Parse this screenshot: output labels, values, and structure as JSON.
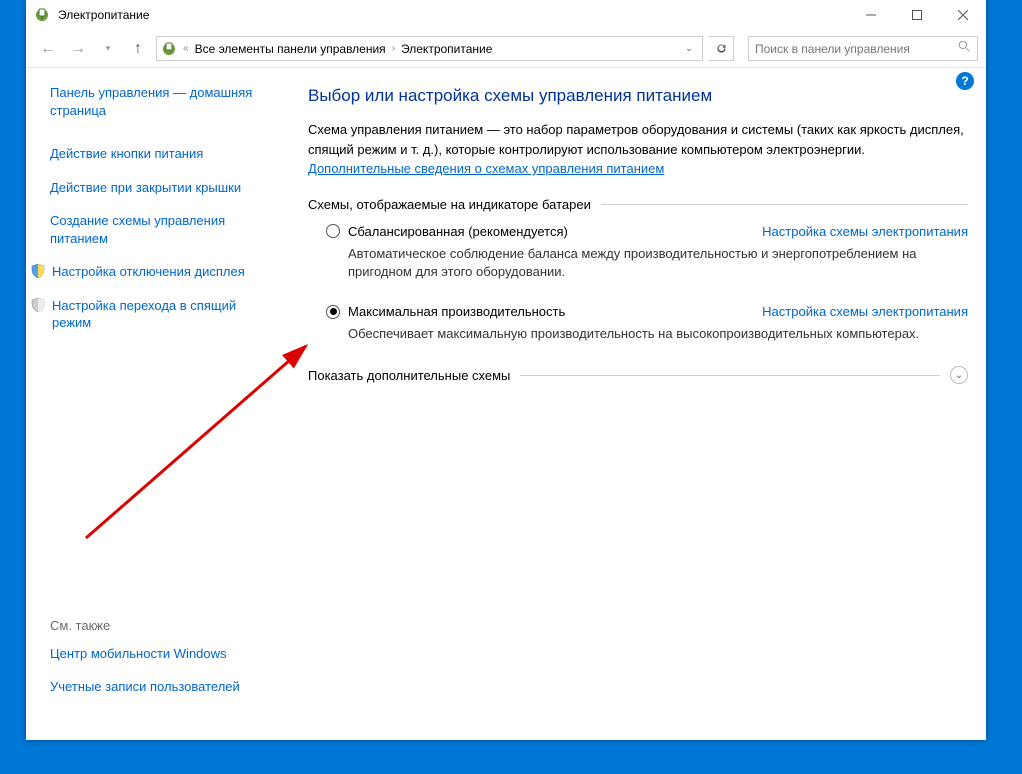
{
  "titlebar": {
    "title": "Электропитание"
  },
  "navbar": {
    "back_symbol": "←",
    "fwd_symbol": "→",
    "up_symbol": "↑",
    "dbl_chev": "«",
    "bc1": "Все элементы панели управления",
    "bc2": "Электропитание",
    "search_placeholder": "Поиск в панели управления"
  },
  "sidebar": {
    "home": "Панель управления — домашняя страница",
    "btn_action": "Действие кнопки питания",
    "lid_action": "Действие при закрытии крышки",
    "create_plan": "Создание схемы управления питанием",
    "display_off": "Настройка отключения дисплея",
    "sleep": "Настройка перехода в спящий режим",
    "see_also": "См. также",
    "mobility": "Центр мобильности Windows",
    "accounts": "Учетные записи пользователей"
  },
  "main": {
    "heading": "Выбор или настройка схемы управления питанием",
    "intro_text": "Схема управления питанием — это набор параметров оборудования и системы (таких как яркость дисплея, спящий режим и т. д.), которые контролируют использование компьютером электроэнергии. ",
    "intro_link": "Дополнительные сведения о схемах управления питанием",
    "legend": "Схемы, отображаемые на индикаторе батареи",
    "plan1": {
      "name": "Сбалансированная (рекомендуется)",
      "link": "Настройка схемы электропитания",
      "desc": "Автоматическое соблюдение баланса между производительностью и энергопотреблением на пригодном для этого оборудовании."
    },
    "plan2": {
      "name": "Максимальная производительность",
      "link": "Настройка схемы электропитания",
      "desc": "Обеспечивает максимальную производительность на высокопроизводительных компьютерах."
    },
    "expander": "Показать дополнительные схемы"
  }
}
